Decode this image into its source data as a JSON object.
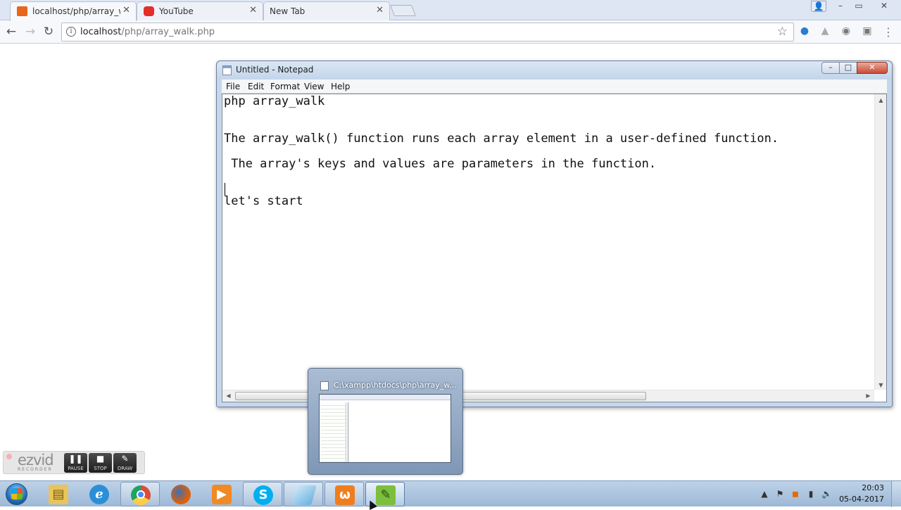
{
  "browser": {
    "tabs": [
      {
        "title": "localhost/php/array_walk",
        "active": true,
        "icon": "xampp-favicon-icon",
        "icon_color": "#e8651c"
      },
      {
        "title": "YouTube",
        "active": false,
        "icon": "youtube-favicon-icon",
        "icon_color": "#e52d27"
      },
      {
        "title": "New Tab",
        "active": false,
        "icon": "none"
      }
    ],
    "window_controls": {
      "minimize": "–",
      "maximize": "▭",
      "close": "✕"
    },
    "url": {
      "host": "localhost",
      "path": "/php/array_walk.php"
    },
    "nav": {
      "back": "←",
      "forward": "→",
      "reload": "↻"
    }
  },
  "notepad": {
    "title": "Untitled - Notepad",
    "menu": [
      "File",
      "Edit",
      "Format",
      "View",
      "Help"
    ],
    "lines": [
      "php array_walk",
      "",
      "The array_walk() function runs each array element in a user-defined function.",
      "",
      " The array's keys and values are parameters in the function.",
      "",
      "",
      "let's start"
    ],
    "controls": {
      "minimize": "–",
      "maximize": "□",
      "close": "✕"
    }
  },
  "thumbnail_preview": {
    "title": "C:\\xampp\\htdocs\\php\\array_w..."
  },
  "ezvid": {
    "logo": "ezvid",
    "subtitle": "RECORDER",
    "buttons": [
      {
        "label": "PAUSE",
        "glyph": "❚❚"
      },
      {
        "label": "STOP",
        "glyph": "■"
      },
      {
        "label": "DRAW",
        "glyph": "✎"
      }
    ]
  },
  "taskbar": {
    "items": [
      {
        "name": "explorer",
        "icon": "folder-icon",
        "color": "#e9c45a",
        "state": "pinned"
      },
      {
        "name": "internet-explorer",
        "icon": "ie-icon",
        "color": "#2b8fd8",
        "state": "pinned"
      },
      {
        "name": "chrome",
        "icon": "chrome-icon",
        "color": "#dd4b39",
        "state": "running"
      },
      {
        "name": "firefox",
        "icon": "firefox-icon",
        "color": "#e66000",
        "state": "pinned"
      },
      {
        "name": "media-player",
        "icon": "media-player-icon",
        "color": "#f08a24",
        "state": "pinned"
      },
      {
        "name": "skype",
        "icon": "skype-icon",
        "color": "#00aff0",
        "state": "running"
      },
      {
        "name": "notepad-blue",
        "icon": "notepad-icon",
        "color": "#6ab0de",
        "state": "running"
      },
      {
        "name": "xampp",
        "icon": "xampp-icon",
        "color": "#f07d1c",
        "state": "running"
      },
      {
        "name": "notepad-plus-plus",
        "icon": "notepad-plus-plus-icon",
        "color": "#7cbf3c",
        "state": "active"
      }
    ],
    "clock": {
      "time": "20:03",
      "date": "05-04-2017"
    }
  }
}
